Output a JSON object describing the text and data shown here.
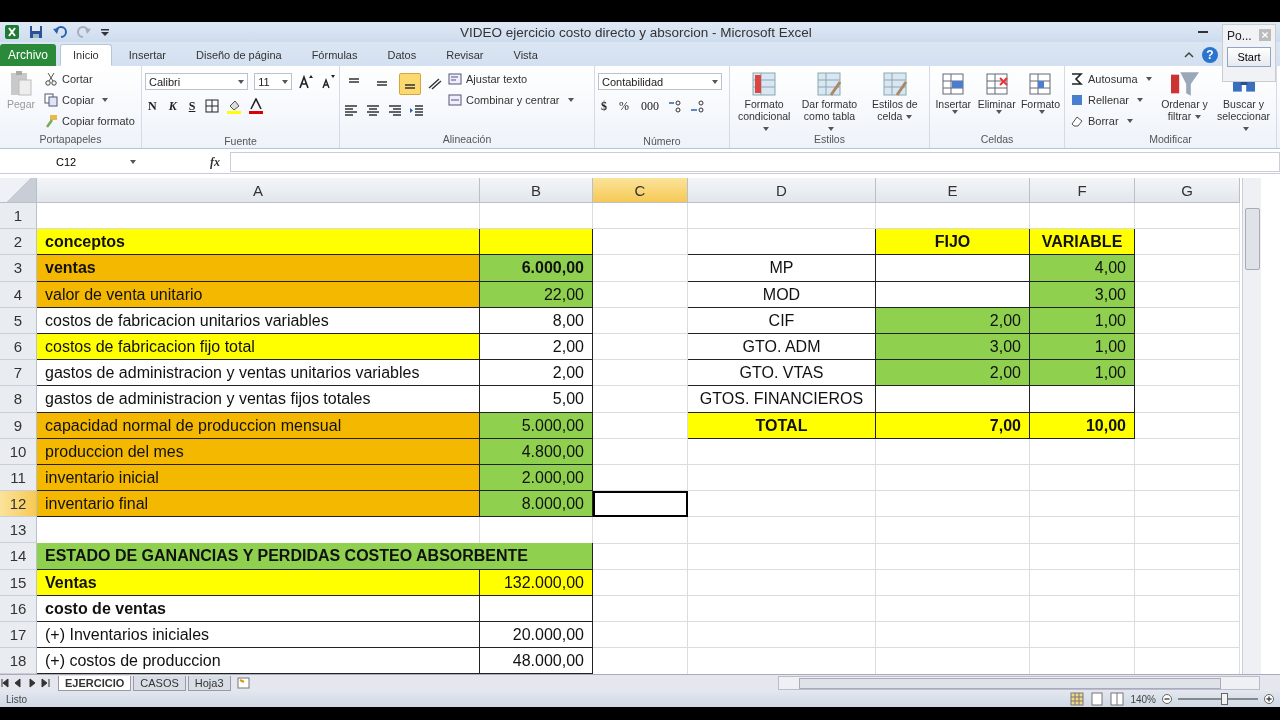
{
  "window": {
    "title": "VIDEO ejercicio costo directo y absorcion  -  Microsoft Excel",
    "help": "?"
  },
  "ribbon_tabs": [
    {
      "label": "Archivo",
      "kind": "file",
      "selected": false
    },
    {
      "label": "Inicio",
      "kind": "tab",
      "selected": true
    },
    {
      "label": "Insertar",
      "kind": "tab",
      "selected": false
    },
    {
      "label": "Diseño de página",
      "kind": "tab",
      "selected": false
    },
    {
      "label": "Fórmulas",
      "kind": "tab",
      "selected": false
    },
    {
      "label": "Datos",
      "kind": "tab",
      "selected": false
    },
    {
      "label": "Revisar",
      "kind": "tab",
      "selected": false
    },
    {
      "label": "Vista",
      "kind": "tab",
      "selected": false
    }
  ],
  "ribbon": {
    "clipboard": {
      "name": "Portapapeles",
      "paste": "Pegar",
      "paste_disabled": true,
      "cut": "Cortar",
      "copy": "Copiar",
      "format_painter": "Copiar formato"
    },
    "font": {
      "name": "Fuente",
      "family": "Calibri",
      "size": "11",
      "bold": "N",
      "italic": "K",
      "underline": "S"
    },
    "alignment": {
      "name": "Alineación",
      "wrap": "Ajustar texto",
      "merge": "Combinar y centrar",
      "vertical_buttons": [
        {
          "selected": false
        },
        {
          "selected": false
        },
        {
          "selected": true
        }
      ]
    },
    "number": {
      "name": "Número",
      "format": "Contabilidad",
      "currency": "$",
      "percent": "%",
      "thousands": "000"
    },
    "styles": {
      "name": "Estilos",
      "buttons": [
        "Formato condicional",
        "Dar formato como tabla",
        "Estilos de celda"
      ]
    },
    "cells": {
      "name": "Celdas",
      "buttons": [
        "Insertar",
        "Eliminar",
        "Formato"
      ]
    },
    "editing": {
      "name": "Modificar",
      "small": [
        "Autosuma",
        "Rellenar",
        "Borrar"
      ],
      "large": [
        "Ordenar y filtrar",
        "Buscar y seleccionar"
      ]
    }
  },
  "side_panel": {
    "title": "Po...",
    "button": "Start"
  },
  "formula_bar": {
    "name_box": "C12",
    "label": "fx"
  },
  "columns": [
    {
      "label": "A",
      "selected": false
    },
    {
      "label": "B",
      "selected": false
    },
    {
      "label": "C",
      "selected": true
    },
    {
      "label": "D",
      "selected": false
    },
    {
      "label": "E",
      "selected": false
    },
    {
      "label": "F",
      "selected": false
    },
    {
      "label": "G",
      "selected": false
    }
  ],
  "rows": [
    {
      "number": "1",
      "selected": false,
      "cells": [
        {},
        {},
        {},
        {},
        {},
        {},
        {}
      ]
    },
    {
      "number": "2",
      "selected": false,
      "cells": [
        {
          "text": "conceptos",
          "kind": "label",
          "bold": true,
          "color": "#ffff00",
          "bordered": true
        },
        {
          "color": "#ffff00",
          "bordered": true
        },
        {},
        {
          "bordered": true
        },
        {
          "text": "FIJO",
          "kind": "center",
          "bold": true,
          "color": "#ffff00",
          "bordered": true
        },
        {
          "text": "VARIABLE",
          "kind": "center",
          "bold": true,
          "color": "#ffff00",
          "bordered": true
        },
        {}
      ]
    },
    {
      "number": "3",
      "selected": false,
      "cells": [
        {
          "text": "ventas",
          "kind": "label",
          "bold": true,
          "color": "#f5b800",
          "bordered": true
        },
        {
          "text": "6.000,00",
          "kind": "number",
          "bold": true,
          "color": "#8fd14f",
          "bordered": true
        },
        {},
        {
          "text": "MP",
          "kind": "center",
          "bold": false,
          "bordered": true
        },
        {
          "bordered": true
        },
        {
          "text": "4,00",
          "kind": "number",
          "bold": false,
          "color": "#8fd14f",
          "bordered": true
        },
        {}
      ]
    },
    {
      "number": "4",
      "selected": false,
      "cells": [
        {
          "text": "valor de venta unitario",
          "kind": "label",
          "bold": false,
          "color": "#f5b800",
          "bordered": true
        },
        {
          "text": "22,00",
          "kind": "number",
          "bold": false,
          "color": "#8fd14f",
          "bordered": true
        },
        {},
        {
          "text": "MOD",
          "kind": "center",
          "bold": false,
          "bordered": true
        },
        {
          "bordered": true
        },
        {
          "text": "3,00",
          "kind": "number",
          "bold": false,
          "color": "#8fd14f",
          "bordered": true
        },
        {}
      ]
    },
    {
      "number": "5",
      "selected": false,
      "cells": [
        {
          "text": "costos de fabricacion unitarios variables",
          "kind": "label",
          "bold": false,
          "bordered": true
        },
        {
          "text": "8,00",
          "kind": "number",
          "bold": false,
          "bordered": true
        },
        {},
        {
          "text": "CIF",
          "kind": "center",
          "bold": false,
          "bordered": true
        },
        {
          "text": "2,00",
          "kind": "number",
          "bold": false,
          "color": "#8fd14f",
          "bordered": true
        },
        {
          "text": "1,00",
          "kind": "number",
          "bold": false,
          "color": "#8fd14f",
          "bordered": true
        },
        {}
      ]
    },
    {
      "number": "6",
      "selected": false,
      "cells": [
        {
          "text": "costos de fabricacion fijo total",
          "kind": "label",
          "bold": false,
          "color": "#ffff00",
          "bordered": true
        },
        {
          "text": "2,00",
          "kind": "number",
          "bold": false,
          "bordered": true
        },
        {},
        {
          "text": "GTO. ADM",
          "kind": "center",
          "bold": false,
          "bordered": true
        },
        {
          "text": "3,00",
          "kind": "number",
          "bold": false,
          "color": "#8fd14f",
          "bordered": true
        },
        {
          "text": "1,00",
          "kind": "number",
          "bold": false,
          "color": "#8fd14f",
          "bordered": true
        },
        {}
      ]
    },
    {
      "number": "7",
      "selected": false,
      "cells": [
        {
          "text": "gastos de administracion y ventas unitarios variables",
          "kind": "label",
          "bold": false,
          "bordered": true
        },
        {
          "text": "2,00",
          "kind": "number",
          "bold": false,
          "bordered": true
        },
        {},
        {
          "text": "GTO. VTAS",
          "kind": "center",
          "bold": false,
          "bordered": true
        },
        {
          "text": "2,00",
          "kind": "number",
          "bold": false,
          "color": "#8fd14f",
          "bordered": true
        },
        {
          "text": "1,00",
          "kind": "number",
          "bold": false,
          "color": "#8fd14f",
          "bordered": true
        },
        {}
      ]
    },
    {
      "number": "8",
      "selected": false,
      "cells": [
        {
          "text": "gastos de administracion y ventas fijos totales",
          "kind": "label",
          "bold": false,
          "bordered": true
        },
        {
          "text": "5,00",
          "kind": "number",
          "bold": false,
          "bordered": true
        },
        {},
        {
          "text": "GTOS. FINANCIEROS",
          "kind": "center",
          "bold": false,
          "bordered": true
        },
        {
          "bordered": true
        },
        {
          "bordered": true
        },
        {}
      ]
    },
    {
      "number": "9",
      "selected": false,
      "cells": [
        {
          "text": "capacidad normal de produccion mensual",
          "kind": "label",
          "bold": false,
          "color": "#f5b800",
          "bordered": true
        },
        {
          "text": "5.000,00",
          "kind": "number",
          "bold": false,
          "color": "#8fd14f",
          "bordered": true
        },
        {},
        {
          "text": "TOTAL",
          "kind": "center",
          "bold": true,
          "color": "#ffff00",
          "bordered": true
        },
        {
          "text": "7,00",
          "kind": "number",
          "bold": true,
          "color": "#ffff00",
          "bordered": true
        },
        {
          "text": "10,00",
          "kind": "number",
          "bold": true,
          "color": "#ffff00",
          "bordered": true
        },
        {}
      ]
    },
    {
      "number": "10",
      "selected": false,
      "cells": [
        {
          "text": "produccion del mes",
          "kind": "label",
          "bold": false,
          "color": "#f5b800",
          "bordered": true
        },
        {
          "text": "4.800,00",
          "kind": "number",
          "bold": false,
          "color": "#8fd14f",
          "bordered": true
        },
        {},
        {},
        {},
        {},
        {}
      ]
    },
    {
      "number": "11",
      "selected": false,
      "cells": [
        {
          "text": "inventario inicial",
          "kind": "label",
          "bold": false,
          "color": "#f5b800",
          "bordered": true
        },
        {
          "text": "2.000,00",
          "kind": "number",
          "bold": false,
          "color": "#8fd14f",
          "bordered": true
        },
        {},
        {},
        {},
        {},
        {}
      ]
    },
    {
      "number": "12",
      "selected": true,
      "cells": [
        {
          "text": "inventario final",
          "kind": "label",
          "bold": false,
          "color": "#f5b800",
          "bordered": true
        },
        {
          "text": "8.000,00",
          "kind": "number",
          "bold": false,
          "color": "#8fd14f",
          "bordered": true
        },
        {
          "active": true
        },
        {},
        {},
        {},
        {}
      ]
    },
    {
      "number": "13",
      "selected": false,
      "cells": [
        {},
        {},
        {},
        {},
        {},
        {},
        {}
      ]
    },
    {
      "number": "14",
      "selected": false,
      "cells": [
        {
          "text": "ESTADO DE GANANCIAS Y PERDIDAS COSTEO ABSORBENTE",
          "kind": "label",
          "bold": true,
          "color": "#8fd14f",
          "bordered": true,
          "colspan": 2
        },
        {},
        {},
        {},
        {},
        {}
      ]
    },
    {
      "number": "15",
      "selected": false,
      "cells": [
        {
          "text": "Ventas",
          "kind": "label",
          "bold": true,
          "color": "#ffff00",
          "bordered": true
        },
        {
          "text": "132.000,00",
          "kind": "number",
          "bold": false,
          "color": "#ffff00",
          "bordered": true
        },
        {},
        {},
        {},
        {},
        {}
      ]
    },
    {
      "number": "16",
      "selected": false,
      "cells": [
        {
          "text": "costo de ventas",
          "kind": "label",
          "bold": true,
          "bordered": true
        },
        {
          "bordered": true
        },
        {},
        {},
        {},
        {},
        {}
      ]
    },
    {
      "number": "17",
      "selected": false,
      "cells": [
        {
          "text": "(+) Inventarios iniciales",
          "kind": "label",
          "bold": false,
          "bordered": true
        },
        {
          "text": "20.000,00",
          "kind": "number",
          "bold": false,
          "bordered": true
        },
        {},
        {},
        {},
        {},
        {}
      ]
    },
    {
      "number": "18",
      "selected": false,
      "cells": [
        {
          "text": "(+) costos de produccion",
          "kind": "label",
          "bold": false,
          "bordered": true
        },
        {
          "text": "48.000,00",
          "kind": "number",
          "bold": false,
          "bordered": true
        },
        {},
        {},
        {},
        {},
        {}
      ]
    }
  ],
  "sheet_tabs": [
    {
      "label": "EJERCICIO",
      "selected": true
    },
    {
      "label": "CASOS",
      "selected": false
    },
    {
      "label": "Hoja3",
      "selected": false
    }
  ],
  "status_bar": {
    "text": "Listo",
    "zoom": "140%",
    "zoom_slider": {
      "level": 0.57
    }
  }
}
